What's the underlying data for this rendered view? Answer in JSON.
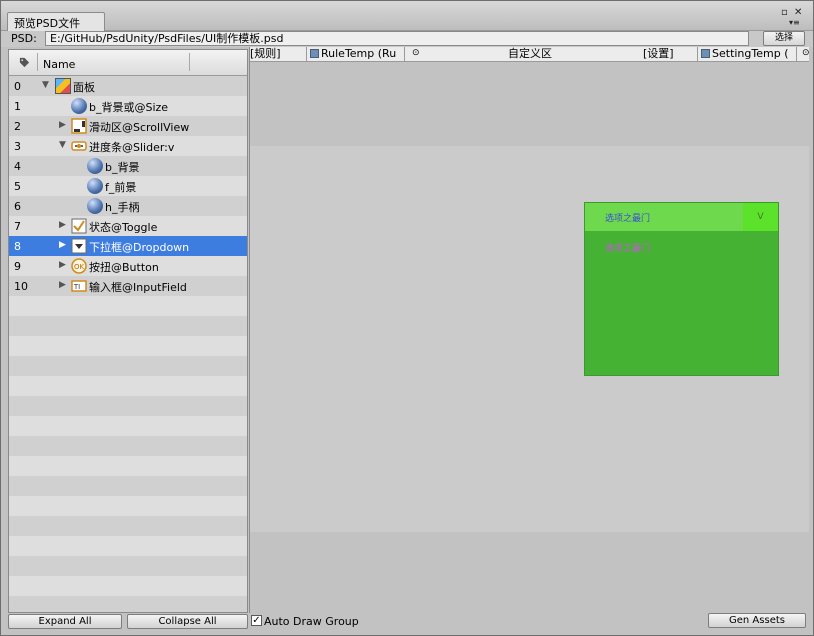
{
  "window": {
    "tab_title": "预览PSD文件",
    "controls": [
      "▫",
      "✕",
      "▾≡"
    ]
  },
  "psd": {
    "label": "PSD:",
    "path": "E:/GitHub/PsdUnity/PsdFiles/UI制作模板.psd",
    "select_button": "选择"
  },
  "tree": {
    "header": {
      "name_column": "Name"
    },
    "rows": [
      {
        "index": "0",
        "label": "面板",
        "arrow": "▼",
        "icon": "cube-icon"
      },
      {
        "index": "1",
        "label": "b_背景或@Size",
        "arrow": "",
        "icon": "sphere-icon"
      },
      {
        "index": "2",
        "label": "滑动区@ScrollView",
        "arrow": "▶",
        "icon": "scrollview-icon"
      },
      {
        "index": "3",
        "label": "进度条@Slider:v",
        "arrow": "▼",
        "icon": "slider-icon"
      },
      {
        "index": "4",
        "label": "b_背景",
        "arrow": "",
        "icon": "sphere-icon"
      },
      {
        "index": "5",
        "label": "f_前景",
        "arrow": "",
        "icon": "sphere-icon"
      },
      {
        "index": "6",
        "label": "h_手柄",
        "arrow": "",
        "icon": "sphere-icon"
      },
      {
        "index": "7",
        "label": "状态@Toggle",
        "arrow": "▶",
        "icon": "checkbox-icon"
      },
      {
        "index": "8",
        "label": "下拉框@Dropdown",
        "arrow": "▶",
        "icon": "dropdown-icon",
        "selected": true
      },
      {
        "index": "9",
        "label": "按扭@Button",
        "arrow": "▶",
        "icon": "ok-button-icon"
      },
      {
        "index": "10",
        "label": "输入框@InputField",
        "arrow": "▶",
        "icon": "inputfield-icon"
      }
    ],
    "expand_all": "Expand All",
    "collapse_all": "Collapse All"
  },
  "toolbar": {
    "rule_label": "[规则]",
    "rule_template": "RuleTemp (Ru",
    "custom_area": "自定义区",
    "settings_label": "[设置]",
    "setting_template": "SettingTemp ("
  },
  "preview": {
    "dropdown_caption": "选项之最门",
    "dropdown_arrow": "V",
    "dropdown_item": "选项之最门"
  },
  "bottom": {
    "auto_draw_group": "Auto Draw Group",
    "auto_draw_checked": true,
    "gen_assets": "Gen Assets"
  },
  "colors": {
    "selection": "#3e7de0",
    "dropdown_body": "#46b233",
    "dropdown_header": "#6fd94d"
  }
}
